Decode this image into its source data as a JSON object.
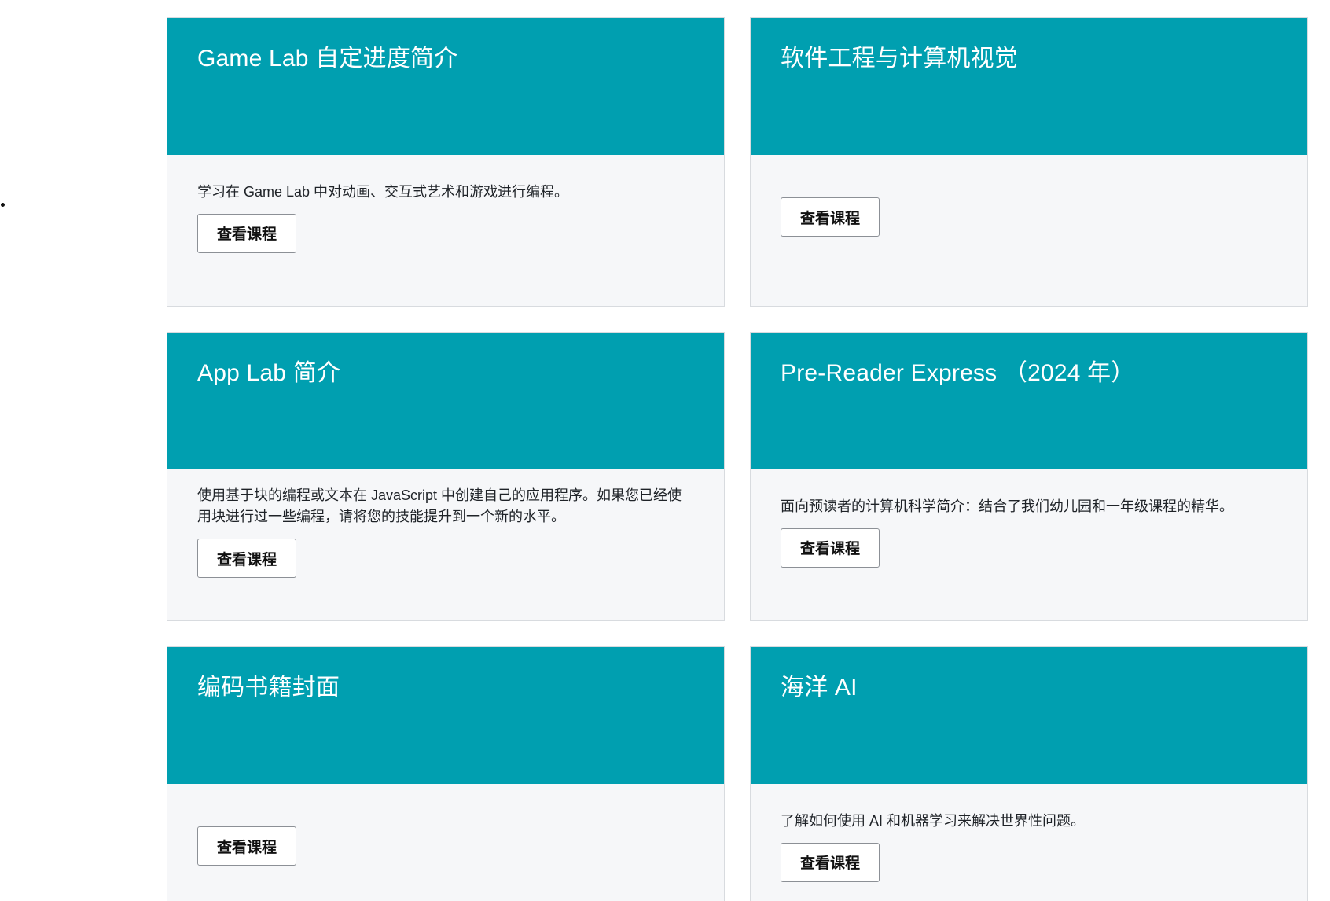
{
  "courses": [
    {
      "title": "Game Lab 自定进度简介",
      "description": "学习在 Game Lab 中对动画、交互式艺术和游戏进行编程。",
      "button_label": "查看课程"
    },
    {
      "title": "软件工程与计算机视觉",
      "description": "",
      "button_label": "查看课程"
    },
    {
      "title": "App Lab 简介",
      "description": "使用基于块的编程或文本在 JavaScript 中创建自己的应用程序。如果您已经使用块进行过一些编程，请将您的技能提升到一个新的水平。",
      "button_label": "查看课程"
    },
    {
      "title": "Pre-Reader Express （2024 年）",
      "description": "面向预读者的计算机科学简介：结合了我们幼儿园和一年级课程的精华。",
      "button_label": "查看课程"
    },
    {
      "title": "编码书籍封面",
      "description": "",
      "button_label": "查看课程"
    },
    {
      "title": "海洋 AI",
      "description": "了解如何使用 AI 和机器学习来解决世界性问题。",
      "button_label": "查看课程"
    }
  ],
  "colors": {
    "header": "#009fb0",
    "card_background": "#f6f7f9"
  }
}
